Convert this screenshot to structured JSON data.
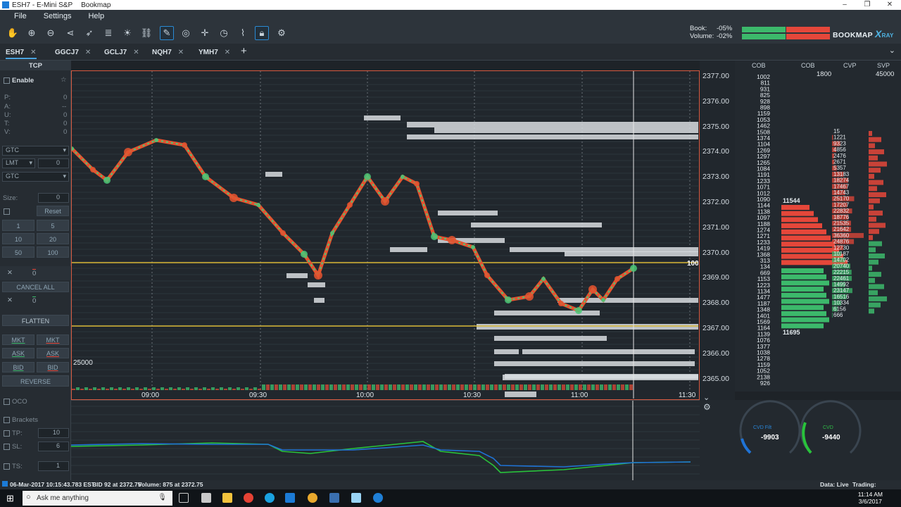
{
  "window": {
    "title": "ESH7 - E-Mini S&P",
    "app": "Bookmap"
  },
  "menu": [
    "File",
    "Settings",
    "Help"
  ],
  "toolbar": {
    "icons": [
      "hand-icon",
      "zoom-in-icon",
      "zoom-out-icon",
      "share-icon",
      "rocket-icon",
      "layers-icon",
      "brightness-icon",
      "link-icon",
      "pencil-icon",
      "chat-icon",
      "crosshair-icon",
      "timer-icon",
      "chart-line-icon",
      "lock-icon",
      "gear-icon"
    ]
  },
  "book_volume": {
    "book_label": "Book:",
    "book_pct": "-05%",
    "volume_label": "Volume:",
    "volume_pct": "-02%",
    "bid_color": "#3cb96b",
    "ask_color": "#e5473a"
  },
  "brand": {
    "name": "BOOKMAP",
    "x": "X",
    "ray": "RAY"
  },
  "tabs": [
    {
      "label": "ESH7"
    },
    {
      "label": "GGCJ7"
    },
    {
      "label": "GCLJ7"
    },
    {
      "label": "NQH7"
    },
    {
      "label": "YMH7"
    }
  ],
  "left": {
    "tcp": "TCP",
    "enable": "Enable",
    "rows": [
      {
        "k": "P:",
        "v": "0"
      },
      {
        "k": "A:",
        "v": "--"
      },
      {
        "k": "U:",
        "v": "0"
      },
      {
        "k": "T:",
        "v": "0"
      },
      {
        "k": "V:",
        "v": "0"
      }
    ],
    "tif": "GTC",
    "order_type": "LMT",
    "price_qty": "0",
    "tif2": "GTC",
    "size_label": "Size:",
    "size_value": "0",
    "reset": "Reset",
    "qty": [
      "1",
      "5",
      "10",
      "20",
      "50",
      "100"
    ],
    "pos_x": "0",
    "cancel_all": "CANCEL ALL",
    "pos_x2": "0",
    "flatten": "FLATTEN",
    "mkt1": "MKT",
    "mkt2": "MKT",
    "ask1": "ASK",
    "ask2": "ASK",
    "bid1": "BID",
    "bid2": "BID",
    "reverse": "REVERSE",
    "oco": "OCO",
    "brackets": "Brackets",
    "tp_label": "TP:",
    "tp": "10",
    "sl_label": "SL:",
    "sl": "6",
    "ts_label": "TS:",
    "ts": "1"
  },
  "chart": {
    "time_labels": [
      "09:00",
      "09:30",
      "10:00",
      "10:30",
      "11:00",
      "11:30"
    ],
    "volume_scale_label": "25000",
    "last_trade_marker": "100"
  },
  "price_axis": [
    "2377.00",
    "2376.00",
    "2375.00",
    "2374.00",
    "2373.00",
    "2372.00",
    "2371.00",
    "2370.00",
    "2369.00",
    "2368.00",
    "2367.00",
    "2366.00",
    "2365.00"
  ],
  "dom": {
    "headers": [
      "COB",
      "COB",
      "CVP",
      "SVP"
    ],
    "cob_total": "1800",
    "svp_total": "45000",
    "ask_total": "11544",
    "bid_total": "11695",
    "cob_values": [
      "1002",
      "811",
      "931",
      "825",
      "928",
      "898",
      "1159",
      "1053",
      "1462",
      "1508",
      "1374",
      "1104",
      "1269",
      "1297",
      "1265",
      "1084",
      "1191",
      "1233",
      "1071",
      "1012",
      "1090",
      "1144",
      "1138",
      "1097",
      "1188",
      "1274",
      "1271",
      "1233",
      "1419",
      "1368",
      "313",
      "134",
      "669",
      "1153",
      "1223",
      "1134",
      "1477",
      "1187",
      "1348",
      "1401",
      "1569",
      "1164",
      "1139",
      "1076",
      "1377",
      "1038",
      "1278",
      "1159",
      "1052",
      "2138",
      "926"
    ],
    "cvp_values": [
      "15",
      "1221",
      "9323",
      "4856",
      "2476",
      "2671",
      "5357",
      "13183",
      "18274",
      "17467",
      "14743",
      "25170",
      "17207",
      "22832",
      "18776",
      "21535",
      "21642",
      "36360",
      "24876",
      "12730",
      "10187",
      "14702",
      "20740",
      "22215",
      "22461",
      "14992",
      "23147",
      "16516",
      "10334",
      "6156",
      "666"
    ]
  },
  "gauges": {
    "left_label": "CVD Filt",
    "left_value": "-9903",
    "right_label": "CVD",
    "right_value": "-9440"
  },
  "status": {
    "left": "06-Mar-2017 10:15:43.783 EST",
    "bid": "BID 92 at 2372.75",
    "volume": "Volume: 875 at 2372.75",
    "data": "Data: Live",
    "trading": "Trading: Simulated"
  },
  "taskbar": {
    "search": "Ask me anything",
    "time": "11:14 AM",
    "date": "3/6/2017"
  }
}
